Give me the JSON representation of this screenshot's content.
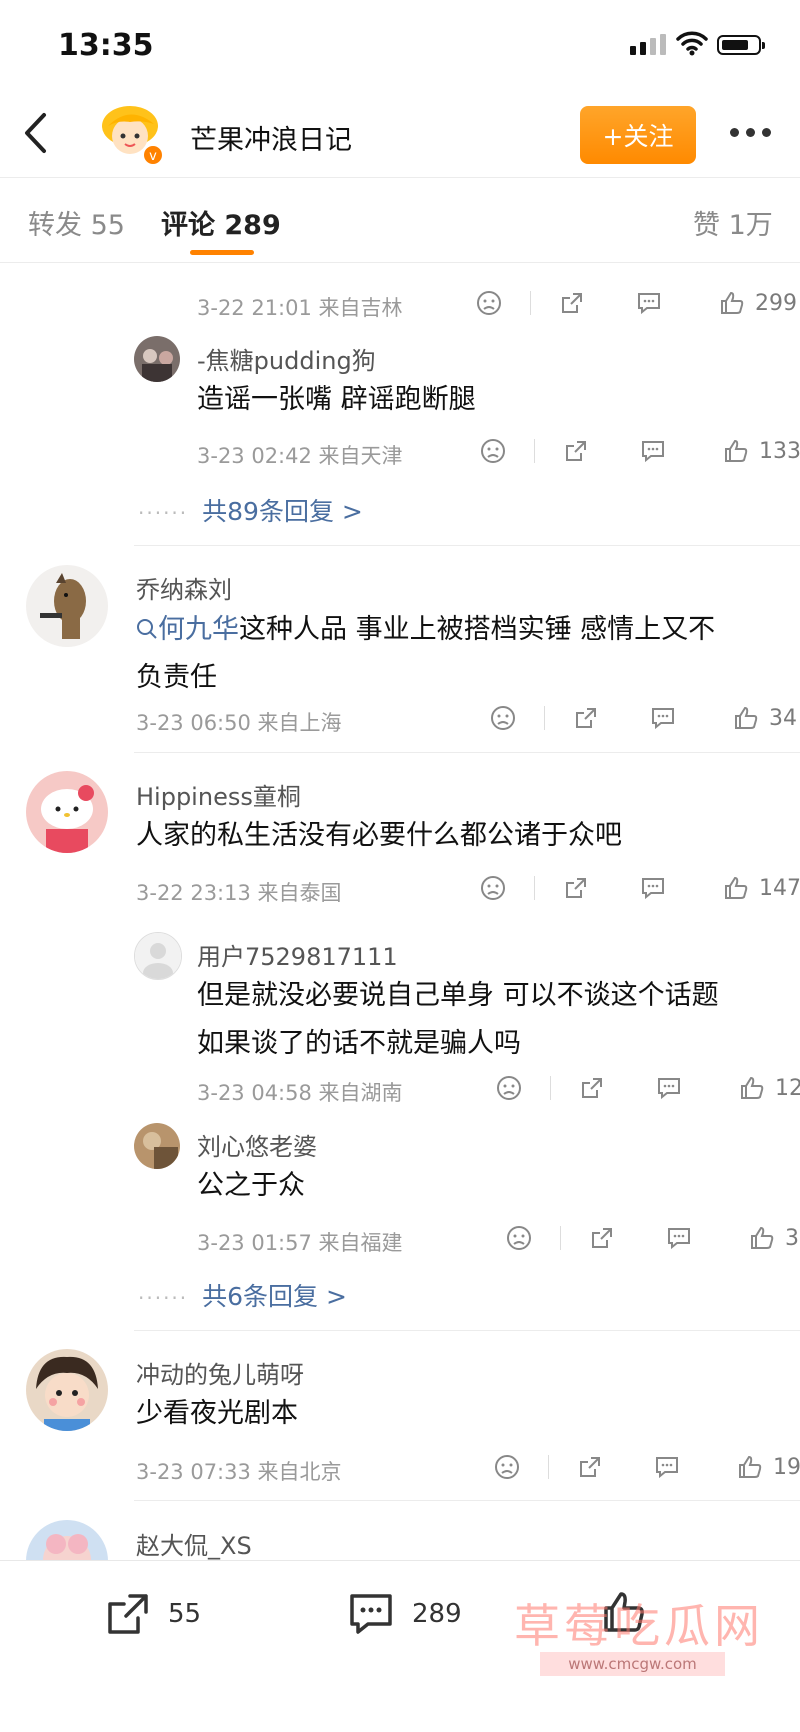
{
  "status_bar": {
    "time": "13:35"
  },
  "header": {
    "account_name": "芒果冲浪日记",
    "follow_label": "+关注"
  },
  "tabs": {
    "repost": "转发 55",
    "comments": "评论 289",
    "likes": "赞 1万"
  },
  "thread1": {
    "reply1": {
      "date": "3-22 21:01",
      "location": "来自吉林",
      "likes": "299"
    },
    "reply2": {
      "username": "-焦糖pudding狗",
      "text": "造谣一张嘴 辟谣跑断腿",
      "date": "3-23 02:42",
      "location": "来自天津",
      "likes": "133"
    },
    "more_replies": "共89条回复 >"
  },
  "comment2": {
    "username": "乔纳森刘",
    "mention": "何九华",
    "text_line1": "这种人品 事业上被搭档实锤 感情上又不",
    "text_line2": "负责任",
    "date": "3-23 06:50",
    "location": "来自上海",
    "likes": "34"
  },
  "comment3": {
    "username": "Hippiness童桐",
    "text": "人家的私生活没有必要什么都公诸于众吧",
    "date": "3-22 23:13",
    "location": "来自泰国",
    "likes": "147",
    "reply1": {
      "username": "用户7529817111",
      "text_line1": "但是就没必要说自己单身 可以不谈这个话题",
      "text_line2": "如果谈了的话不就是骗人吗",
      "date": "3-23 04:58",
      "location": "来自湖南",
      "likes": "12"
    },
    "reply2": {
      "username": "刘心悠老婆",
      "text": "公之于众",
      "date": "3-23 01:57",
      "location": "来自福建",
      "likes": "3"
    },
    "more_replies": "共6条回复 >"
  },
  "comment4": {
    "username": "冲动的兔儿萌呀",
    "text": "少看夜光剧本",
    "date": "3-23 07:33",
    "location": "来自北京",
    "likes": "19"
  },
  "comment5": {
    "username": "赵大侃_XS"
  },
  "bottom_bar": {
    "repost_count": "55",
    "comment_count": "289"
  },
  "watermark": {
    "title": "草莓吃瓜网",
    "url": "www.cmcgw.com"
  },
  "colors": {
    "accent": "#ff8200",
    "link": "#4a6ea0"
  }
}
